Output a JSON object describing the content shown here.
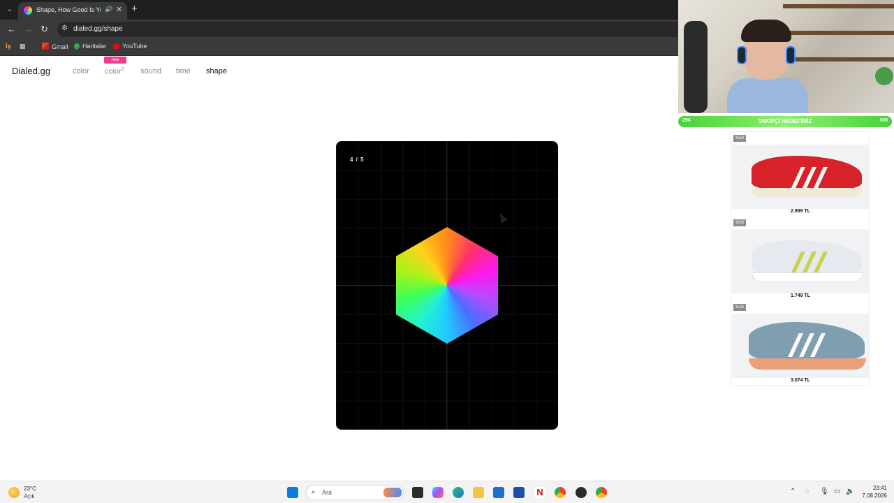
{
  "browser": {
    "tab_title": "Shape, How Good Is Your S",
    "url": "dialed.gg/shape",
    "bookmarks": {
      "first": "İş",
      "gmail": "Gmail",
      "maps": "Haritalar",
      "youtube": "YouTube"
    }
  },
  "site": {
    "logo": "Dialed.gg",
    "nav": {
      "color": "color",
      "color2": "color",
      "color2_sup": "2",
      "color2_badge": "new",
      "sound": "sound",
      "time": "time",
      "shape": "shape"
    }
  },
  "game": {
    "progress": "4 / 5"
  },
  "stream": {
    "follow_goal": {
      "current": "294",
      "label": "TAKİPÇİ HEDEFİMİZ",
      "target": "300"
    },
    "ads": [
      {
        "badge": "%50",
        "price": "2.999 TL",
        "color": "#d62228"
      },
      {
        "badge": "%50",
        "price": "1.749 TL",
        "color": "#eef0f4"
      },
      {
        "badge": "%25",
        "price": "3.074 TL",
        "color": "#7f9fb0"
      }
    ]
  },
  "taskbar": {
    "weather_temp": "23°C",
    "weather_condition": "Açık",
    "search_placeholder": "Ara",
    "time": "23:41",
    "date": "7.08.2026"
  }
}
